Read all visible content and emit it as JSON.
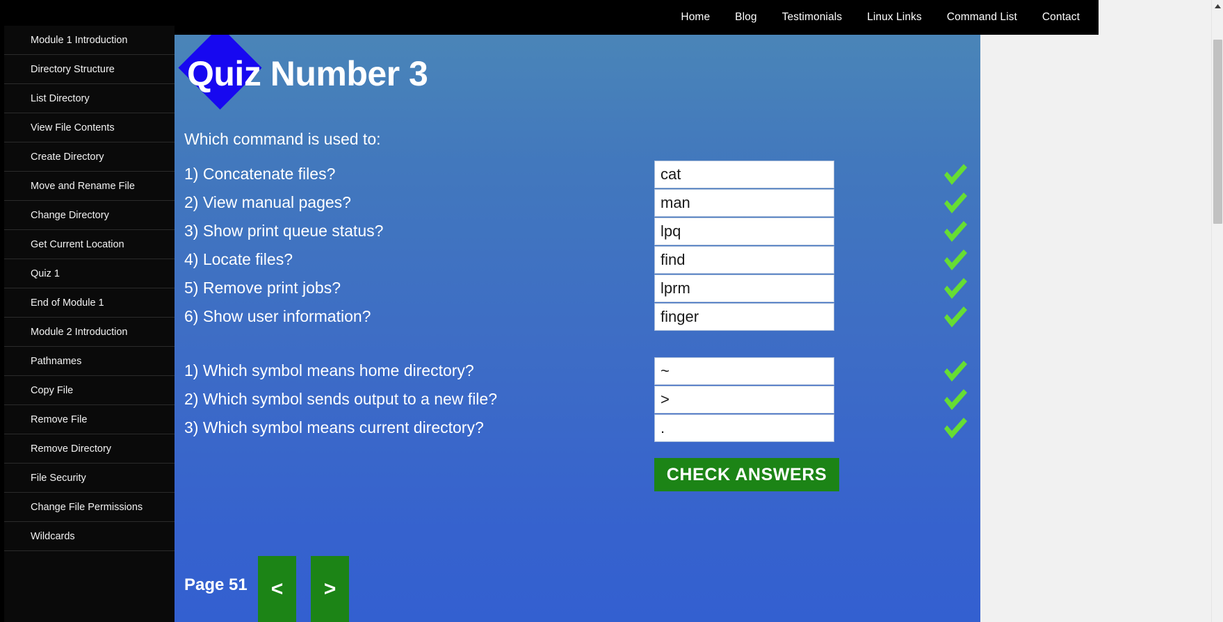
{
  "topnav": {
    "items": [
      {
        "label": "Home"
      },
      {
        "label": "Blog"
      },
      {
        "label": "Testimonials"
      },
      {
        "label": "Linux Links"
      },
      {
        "label": "Command List"
      },
      {
        "label": "Contact"
      }
    ]
  },
  "sidebar": {
    "items": [
      {
        "label": "Module 1 Introduction"
      },
      {
        "label": "Directory Structure"
      },
      {
        "label": "List Directory"
      },
      {
        "label": "View File Contents"
      },
      {
        "label": "Create Directory"
      },
      {
        "label": "Move and Rename File"
      },
      {
        "label": "Change Directory"
      },
      {
        "label": "Get Current Location"
      },
      {
        "label": "Quiz 1"
      },
      {
        "label": "End of Module 1"
      },
      {
        "label": "Module 2 Introduction"
      },
      {
        "label": "Pathnames"
      },
      {
        "label": "Copy File"
      },
      {
        "label": "Remove File"
      },
      {
        "label": "Remove Directory"
      },
      {
        "label": "File Security"
      },
      {
        "label": "Change File Permissions"
      },
      {
        "label": "Wildcards"
      }
    ]
  },
  "main": {
    "title": "Quiz Number 3",
    "prompt": "Which command is used to:",
    "group_one": [
      {
        "question": "1) Concatenate files?",
        "answer": "cat",
        "status": "correct"
      },
      {
        "question": "2) View manual pages?",
        "answer": "man",
        "status": "correct"
      },
      {
        "question": "3) Show print queue status?",
        "answer": "lpq",
        "status": "correct"
      },
      {
        "question": "4) Locate files?",
        "answer": "find",
        "status": "correct"
      },
      {
        "question": "5) Remove print jobs?",
        "answer": "lprm",
        "status": "correct"
      },
      {
        "question": "6) Show user information?",
        "answer": "finger",
        "status": "correct"
      }
    ],
    "group_two": [
      {
        "question": "1) Which symbol means home directory?",
        "answer": "~",
        "status": "correct"
      },
      {
        "question": "2) Which symbol sends output to a new file?",
        "answer": ">",
        "status": "correct"
      },
      {
        "question": "3) Which symbol means current directory?",
        "answer": ".",
        "status": "correct"
      }
    ],
    "check_button": "CHECK ANSWERS",
    "page_label": "Page 51",
    "prev_button": "<",
    "next_button": ">"
  },
  "colors": {
    "topbar_bg": "#000000",
    "sidebar_bg": "#0a0a0a",
    "content_gradient_top": "#4a85b8",
    "content_gradient_bottom": "#3360d0",
    "diamond_blue": "#1708f0",
    "button_green": "#1c8416",
    "check_green": "#66dd33",
    "text_white": "#ffffff"
  },
  "icons": {
    "checkmark": "check-mark-icon",
    "scroll_up": "scroll-up-arrow-icon"
  }
}
